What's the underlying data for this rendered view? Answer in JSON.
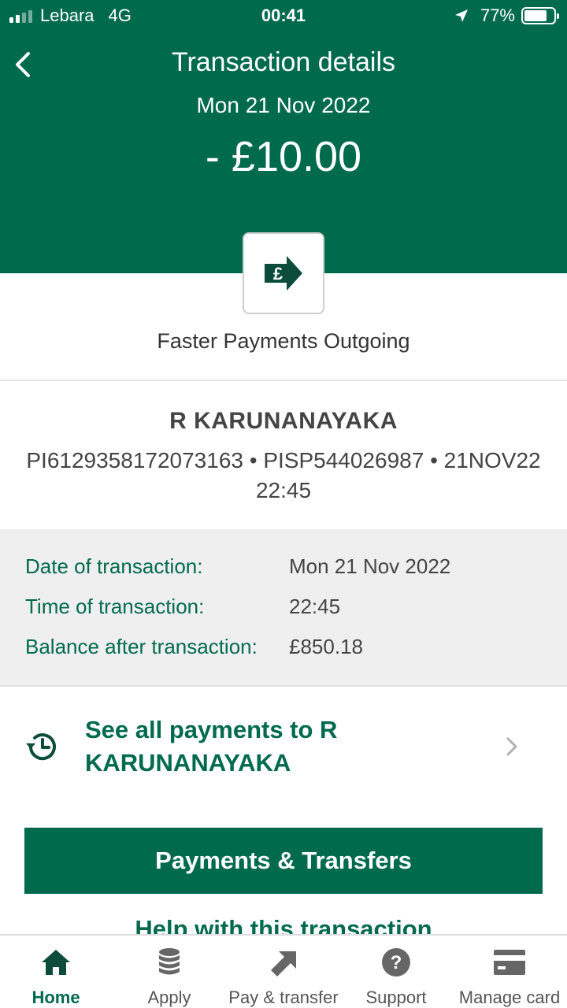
{
  "status_bar": {
    "carrier": "Lebara",
    "network": "4G",
    "time": "00:41",
    "battery": "77%",
    "battery_level": 0.77
  },
  "header": {
    "title": "Transaction details",
    "date": "Mon 21 Nov 2022",
    "amount": "- £10.00",
    "background_color": "#006a4d"
  },
  "transaction": {
    "type_icon": "pound-arrow-icon",
    "type_label": "Faster Payments Outgoing",
    "payee": "R KARUNANAYAKA",
    "reference": "PI6129358172073163 • PISP544026987 • 21NOV22 22:45"
  },
  "details": [
    {
      "label": "Date of transaction:",
      "value": "Mon 21 Nov 2022"
    },
    {
      "label": "Time of transaction:",
      "value": "22:45"
    },
    {
      "label": "Balance after transaction:",
      "value": "£850.18"
    }
  ],
  "see_all": {
    "icon": "history-icon",
    "label": "See all payments to R KARUNANAYAKA"
  },
  "actions": {
    "primary_button": "Payments & Transfers",
    "help_link": "Help with this transaction"
  },
  "tab_bar": {
    "items": [
      {
        "label": "Home",
        "icon": "home-icon",
        "active": true
      },
      {
        "label": "Apply",
        "icon": "coins-icon",
        "active": false
      },
      {
        "label": "Pay & transfer",
        "icon": "transfer-arrows-icon",
        "active": false
      },
      {
        "label": "Support",
        "icon": "question-icon",
        "active": false
      },
      {
        "label": "Manage card",
        "icon": "card-icon",
        "active": false
      }
    ]
  },
  "colors": {
    "brand_green": "#006a4d",
    "details_background": "#efefef",
    "inactive_icon": "#666666"
  }
}
